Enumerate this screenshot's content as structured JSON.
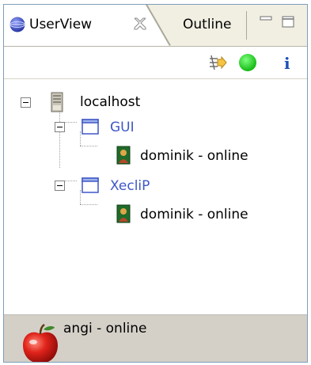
{
  "tabs": {
    "active_label": "UserView",
    "inactive_label": "Outline"
  },
  "icons": {
    "tab": "globe-icon",
    "close": "close-icon",
    "minimize": "minimize-icon",
    "maximize": "maximize-icon",
    "connect": "connect-arrows-icon",
    "status": "green-status-icon",
    "info": "info-icon",
    "server": "server-icon",
    "window": "window-icon",
    "user": "user-icon",
    "avatar": "apple-avatar-icon"
  },
  "tree": {
    "root": {
      "label": "localhost"
    },
    "groups": [
      {
        "label": "GUI",
        "users": [
          {
            "label": "dominik - online"
          }
        ]
      },
      {
        "label": "XecliP",
        "users": [
          {
            "label": "dominik - online"
          }
        ]
      }
    ]
  },
  "status": {
    "label": "angi - online"
  },
  "colors": {
    "link": "#3f57c8",
    "status_green": "#22cc22",
    "info_blue": "#1d4fb8",
    "status_bg": "#d4d0c8"
  }
}
